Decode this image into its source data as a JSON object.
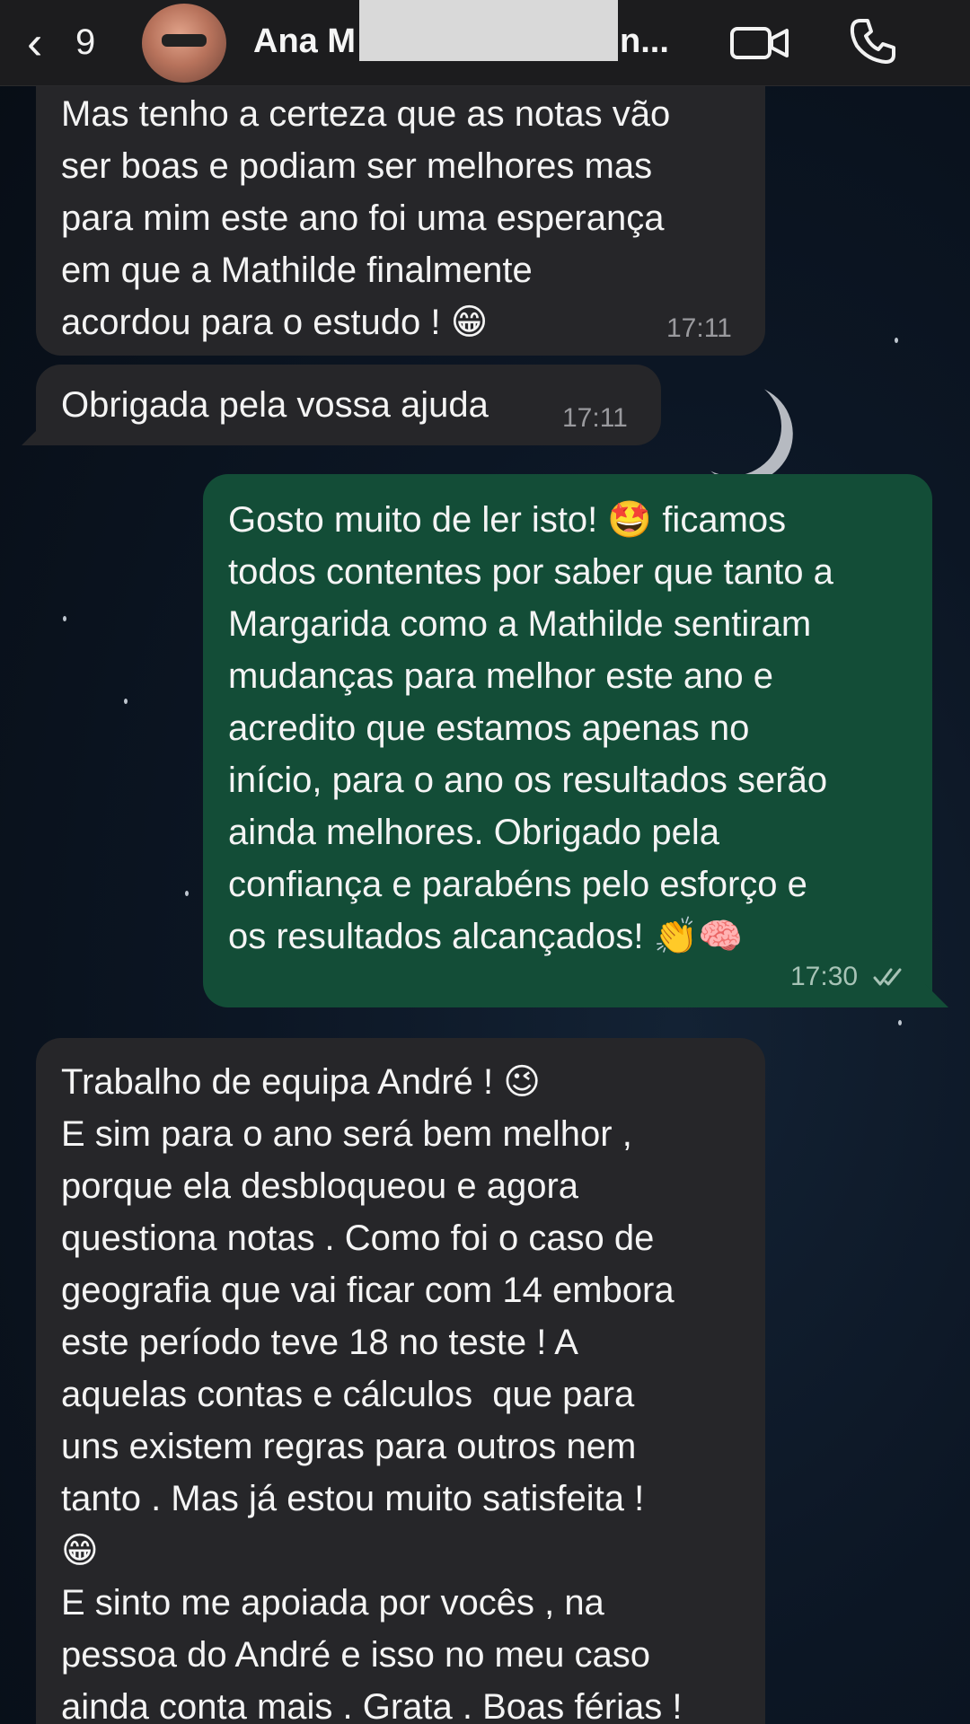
{
  "header": {
    "back_count": "9",
    "contact_name": "Ana M",
    "contact_name_tail": "n...",
    "icons": {
      "back": "chevron-left-icon",
      "video": "video-call-icon",
      "phone": "voice-call-icon"
    }
  },
  "messages": [
    {
      "direction": "incoming",
      "text": "Mas tenho a certeza que as notas vão\nser boas e podiam ser melhores mas\npara mim este ano foi uma esperança\nem que a Mathilde finalmente\nacordou para o estudo ! 😁",
      "time": "17:11"
    },
    {
      "direction": "incoming",
      "text": "Obrigada pela vossa ajuda",
      "time": "17:11"
    },
    {
      "direction": "outgoing",
      "text": "Gosto muito de ler isto! 🤩 ficamos\ntodos contentes por saber que tanto a\nMargarida como a Mathilde sentiram\nmudanças para melhor este ano e\nacredito que estamos apenas no\ninício, para o ano os resultados serão\nainda melhores. Obrigado pela\nconfiança e parabéns pelo esforço e\nos resultados alcançados! 👏🧠",
      "time": "17:30",
      "status": "read"
    },
    {
      "direction": "incoming",
      "text": "Trabalho de equipa André ! 😉\nE sim para o ano será bem melhor ,\nporque ela desbloqueou e agora\nquestiona notas . Como foi o caso de\ngeografia que vai ficar com 14 embora\neste período teve 18 no teste ! A\naquelas contas e cálculos  que para\nuns existem regras para outros nem\ntanto . Mas já estou muito satisfeita !\n😁\nE sinto me apoiada por vocês , na\npessoa do André e isso no meu caso\nainda conta mais . Grata . Boas férias !",
      "time": ""
    }
  ],
  "colors": {
    "header_bg": "#1c1c1e",
    "incoming_bubble": "#262629",
    "outgoing_bubble": "#134d37",
    "text": "#f4f4f4",
    "time_text": "#9a9a9e"
  }
}
